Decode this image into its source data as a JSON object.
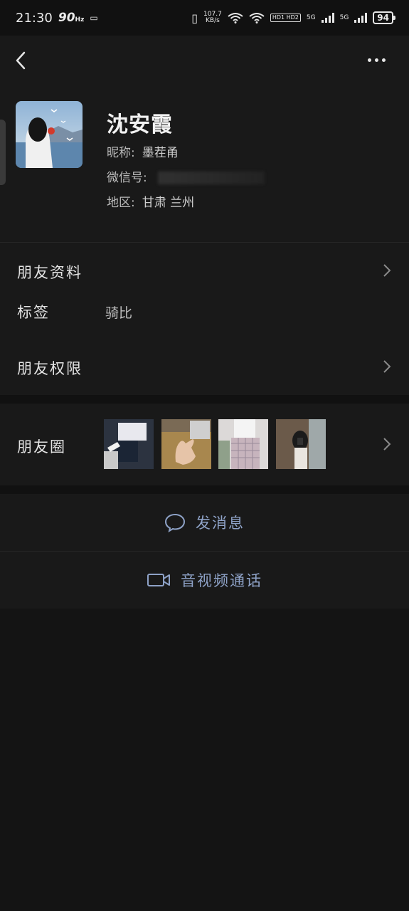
{
  "status_bar": {
    "time": "21:30",
    "refresh_rate": "90",
    "refresh_unit": "Hz",
    "net_speed_value": "107.7",
    "net_speed_unit": "KB/s",
    "hd_tag": "HD1 HD2",
    "sim1": "5G",
    "sim2": "5G",
    "battery": "94"
  },
  "profile": {
    "display_name": "沈安霞",
    "nickname_label": "昵称:",
    "nickname_value": "墨茬甬",
    "wechat_id_label": "微信号:",
    "region_label": "地区:",
    "region_value": "甘肃  兰州"
  },
  "rows": {
    "friend_info": "朋友资料",
    "tags_label": "标签",
    "tags_value": "骑比",
    "friend_permissions": "朋友权限",
    "moments": "朋友圈"
  },
  "actions": {
    "send_message": "发消息",
    "video_call": "音视频通话"
  },
  "colors": {
    "background": "#191919",
    "section_divider": "#111111",
    "action_text": "#8ea2c7"
  }
}
